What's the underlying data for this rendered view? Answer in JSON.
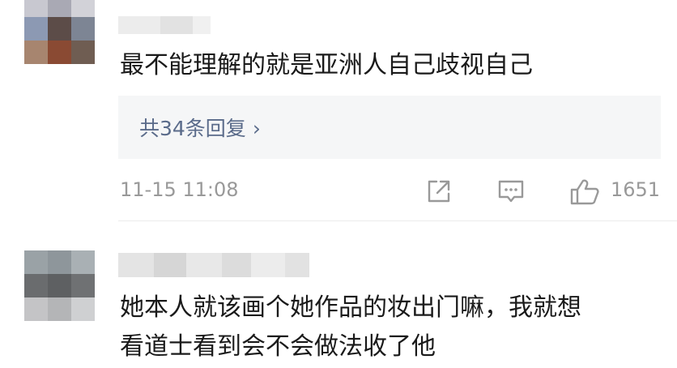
{
  "comments": [
    {
      "text": "最不能理解的就是亚洲人自己歧视自己",
      "replies_label": "共34条回复",
      "replies_chevron": "›",
      "timestamp": "11-15 11:08",
      "likes": "1651",
      "avatar_colors": [
        "#c8c8d0",
        "#a9a9b4",
        "#d2d2d8",
        "#8c99b3",
        "#5c4c48",
        "#7d8594",
        "#a7856f",
        "#8a4a33",
        "#6f5d52"
      ]
    },
    {
      "text_lines": [
        "她本人就该画个她作品的妆出门嘛，我就想",
        "看道士看到会不会做法收了他"
      ],
      "avatar_colors": [
        "#9aa2a6",
        "#8e969b",
        "#a9b0b4",
        "#6a6c6e",
        "#5e6062",
        "#6f7173",
        "#c4c4c6",
        "#b4b5b7",
        "#cfd0d2"
      ]
    }
  ],
  "icons": {
    "share": "share-icon",
    "comment": "comment-icon",
    "like": "thumbs-up-icon"
  }
}
